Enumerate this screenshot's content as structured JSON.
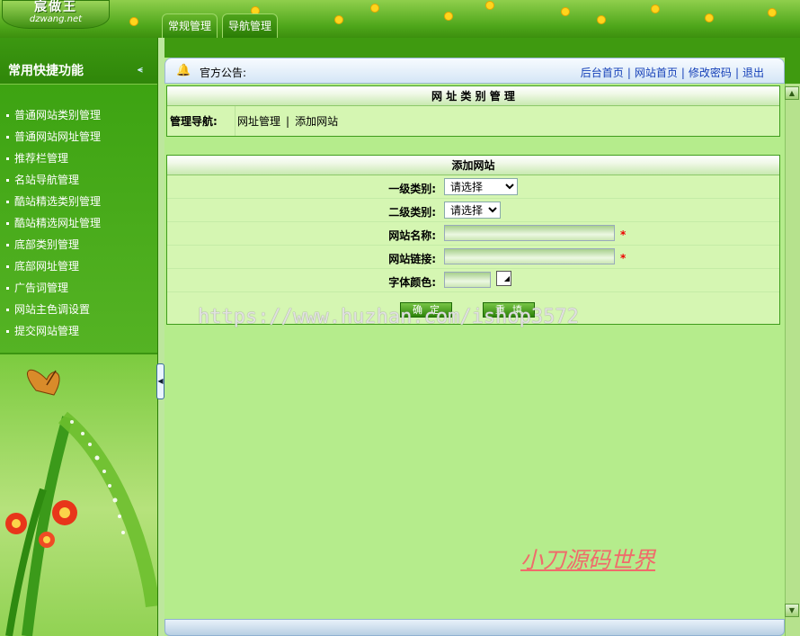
{
  "logo": {
    "title": "宸做王",
    "domain": "dzwang.net"
  },
  "nav_tabs": [
    {
      "label": "常规管理"
    },
    {
      "label": "导航管理"
    }
  ],
  "sidebar": {
    "title": "常用快捷功能",
    "items": [
      {
        "label": "普通网站类别管理"
      },
      {
        "label": "普通网站网址管理"
      },
      {
        "label": "推荐栏管理"
      },
      {
        "label": "名站导航管理"
      },
      {
        "label": "酷站精选类别管理"
      },
      {
        "label": "酷站精选网址管理"
      },
      {
        "label": "底部类别管理"
      },
      {
        "label": "底部网址管理"
      },
      {
        "label": "广告词管理"
      },
      {
        "label": "网站主色调设置"
      },
      {
        "label": "提交网站管理"
      }
    ]
  },
  "header": {
    "notice_label": "官方公告:",
    "links": [
      "后台首页",
      "网站首页",
      "修改密码",
      "退出"
    ],
    "separator": "|"
  },
  "panel1": {
    "title": "网 址 类 别 管 理",
    "crumb_label": "管理导航:",
    "crumb_links": [
      "网址管理",
      "添加网站"
    ],
    "separator": "|"
  },
  "panel2": {
    "title": "添加网站",
    "fields": {
      "level1": {
        "label": "一级类别:",
        "value": "请选择"
      },
      "level2": {
        "label": "二级类别:",
        "value": "请选择"
      },
      "name": {
        "label": "网站名称:",
        "value": "",
        "required_mark": "*"
      },
      "link": {
        "label": "网站链接:",
        "value": "",
        "required_mark": "*"
      },
      "color": {
        "label": "字体颜色:",
        "value": ""
      }
    },
    "buttons": {
      "submit": "确定",
      "reset": "重填"
    }
  },
  "watermark": "https://www.huzhan.com/ishop3572",
  "signature": "小刀源码世界",
  "colors": {
    "accent_green": "#3b9511",
    "panel_bg": "#d5f6b2",
    "main_bg": "#b5ec8c",
    "link_blue": "#1540b8"
  }
}
